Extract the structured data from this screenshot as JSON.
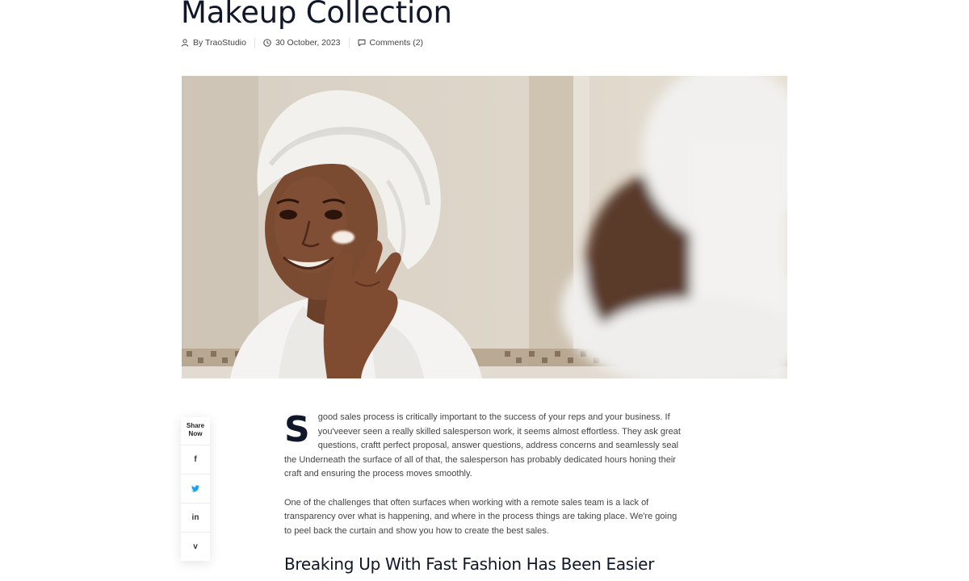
{
  "post": {
    "title": "Makeup Collection",
    "meta": {
      "author": "By TraoStudio",
      "date": "30 October, 2023",
      "comments": "Comments (2)"
    },
    "hero_image_alt": "Woman with towel on head applying cream in front of mirror"
  },
  "share": {
    "label_line1": "Share",
    "label_line2": "Now",
    "buttons": [
      {
        "icon": "facebook-icon",
        "glyph": "f"
      },
      {
        "icon": "twitter-icon",
        "glyph": "🐦"
      },
      {
        "icon": "linkedin-icon",
        "glyph": "in"
      },
      {
        "icon": "vimeo-icon",
        "glyph": "v"
      }
    ]
  },
  "content": {
    "dropcap": "S",
    "paragraph1": "good sales process is critically important to the success of your reps and your business. If you'veever seen a really skilled salesperson work, it seems almost effortless. They ask great questions, craftt perfect proposal, answer questions, address concerns and seamlessly seal the Underneath the surface of all of that, the salesperson has probably dedicated hours honing their craft and ensuring the process moves smoothly.",
    "paragraph2": "One of the challenges that often surfaces when  working with a remote sales team is a lack of transparency over what is happening, and where in the process things are taking place. We're going to peel back the curtain and show you how to create the best sales.",
    "heading": "Breaking Up With Fast Fashion Has Been Easier"
  },
  "colors": {
    "title": "#0f1729",
    "body_text": "#444444",
    "twitter": "#1da1f2"
  }
}
